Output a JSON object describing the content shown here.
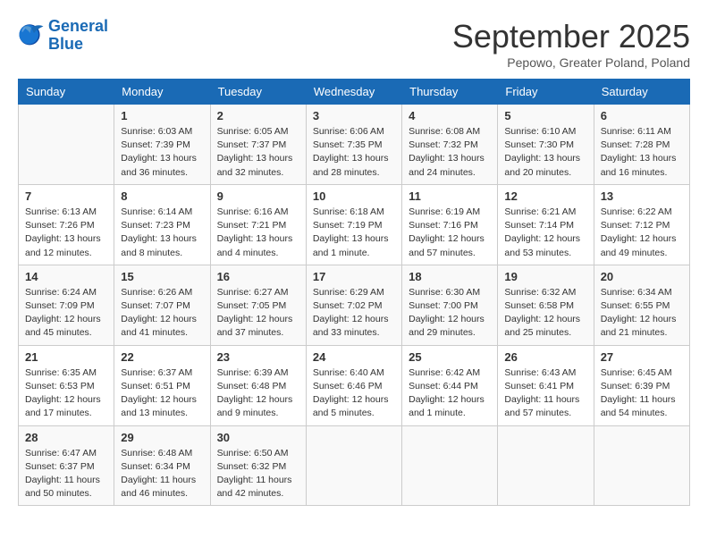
{
  "header": {
    "logo": {
      "line1": "General",
      "line2": "Blue"
    },
    "title": "September 2025",
    "location": "Pepowo, Greater Poland, Poland"
  },
  "days_of_week": [
    "Sunday",
    "Monday",
    "Tuesday",
    "Wednesday",
    "Thursday",
    "Friday",
    "Saturday"
  ],
  "weeks": [
    [
      {
        "day": "",
        "info": ""
      },
      {
        "day": "1",
        "info": "Sunrise: 6:03 AM\nSunset: 7:39 PM\nDaylight: 13 hours\nand 36 minutes."
      },
      {
        "day": "2",
        "info": "Sunrise: 6:05 AM\nSunset: 7:37 PM\nDaylight: 13 hours\nand 32 minutes."
      },
      {
        "day": "3",
        "info": "Sunrise: 6:06 AM\nSunset: 7:35 PM\nDaylight: 13 hours\nand 28 minutes."
      },
      {
        "day": "4",
        "info": "Sunrise: 6:08 AM\nSunset: 7:32 PM\nDaylight: 13 hours\nand 24 minutes."
      },
      {
        "day": "5",
        "info": "Sunrise: 6:10 AM\nSunset: 7:30 PM\nDaylight: 13 hours\nand 20 minutes."
      },
      {
        "day": "6",
        "info": "Sunrise: 6:11 AM\nSunset: 7:28 PM\nDaylight: 13 hours\nand 16 minutes."
      }
    ],
    [
      {
        "day": "7",
        "info": "Sunrise: 6:13 AM\nSunset: 7:26 PM\nDaylight: 13 hours\nand 12 minutes."
      },
      {
        "day": "8",
        "info": "Sunrise: 6:14 AM\nSunset: 7:23 PM\nDaylight: 13 hours\nand 8 minutes."
      },
      {
        "day": "9",
        "info": "Sunrise: 6:16 AM\nSunset: 7:21 PM\nDaylight: 13 hours\nand 4 minutes."
      },
      {
        "day": "10",
        "info": "Sunrise: 6:18 AM\nSunset: 7:19 PM\nDaylight: 13 hours\nand 1 minute."
      },
      {
        "day": "11",
        "info": "Sunrise: 6:19 AM\nSunset: 7:16 PM\nDaylight: 12 hours\nand 57 minutes."
      },
      {
        "day": "12",
        "info": "Sunrise: 6:21 AM\nSunset: 7:14 PM\nDaylight: 12 hours\nand 53 minutes."
      },
      {
        "day": "13",
        "info": "Sunrise: 6:22 AM\nSunset: 7:12 PM\nDaylight: 12 hours\nand 49 minutes."
      }
    ],
    [
      {
        "day": "14",
        "info": "Sunrise: 6:24 AM\nSunset: 7:09 PM\nDaylight: 12 hours\nand 45 minutes."
      },
      {
        "day": "15",
        "info": "Sunrise: 6:26 AM\nSunset: 7:07 PM\nDaylight: 12 hours\nand 41 minutes."
      },
      {
        "day": "16",
        "info": "Sunrise: 6:27 AM\nSunset: 7:05 PM\nDaylight: 12 hours\nand 37 minutes."
      },
      {
        "day": "17",
        "info": "Sunrise: 6:29 AM\nSunset: 7:02 PM\nDaylight: 12 hours\nand 33 minutes."
      },
      {
        "day": "18",
        "info": "Sunrise: 6:30 AM\nSunset: 7:00 PM\nDaylight: 12 hours\nand 29 minutes."
      },
      {
        "day": "19",
        "info": "Sunrise: 6:32 AM\nSunset: 6:58 PM\nDaylight: 12 hours\nand 25 minutes."
      },
      {
        "day": "20",
        "info": "Sunrise: 6:34 AM\nSunset: 6:55 PM\nDaylight: 12 hours\nand 21 minutes."
      }
    ],
    [
      {
        "day": "21",
        "info": "Sunrise: 6:35 AM\nSunset: 6:53 PM\nDaylight: 12 hours\nand 17 minutes."
      },
      {
        "day": "22",
        "info": "Sunrise: 6:37 AM\nSunset: 6:51 PM\nDaylight: 12 hours\nand 13 minutes."
      },
      {
        "day": "23",
        "info": "Sunrise: 6:39 AM\nSunset: 6:48 PM\nDaylight: 12 hours\nand 9 minutes."
      },
      {
        "day": "24",
        "info": "Sunrise: 6:40 AM\nSunset: 6:46 PM\nDaylight: 12 hours\nand 5 minutes."
      },
      {
        "day": "25",
        "info": "Sunrise: 6:42 AM\nSunset: 6:44 PM\nDaylight: 12 hours\nand 1 minute."
      },
      {
        "day": "26",
        "info": "Sunrise: 6:43 AM\nSunset: 6:41 PM\nDaylight: 11 hours\nand 57 minutes."
      },
      {
        "day": "27",
        "info": "Sunrise: 6:45 AM\nSunset: 6:39 PM\nDaylight: 11 hours\nand 54 minutes."
      }
    ],
    [
      {
        "day": "28",
        "info": "Sunrise: 6:47 AM\nSunset: 6:37 PM\nDaylight: 11 hours\nand 50 minutes."
      },
      {
        "day": "29",
        "info": "Sunrise: 6:48 AM\nSunset: 6:34 PM\nDaylight: 11 hours\nand 46 minutes."
      },
      {
        "day": "30",
        "info": "Sunrise: 6:50 AM\nSunset: 6:32 PM\nDaylight: 11 hours\nand 42 minutes."
      },
      {
        "day": "",
        "info": ""
      },
      {
        "day": "",
        "info": ""
      },
      {
        "day": "",
        "info": ""
      },
      {
        "day": "",
        "info": ""
      }
    ]
  ]
}
